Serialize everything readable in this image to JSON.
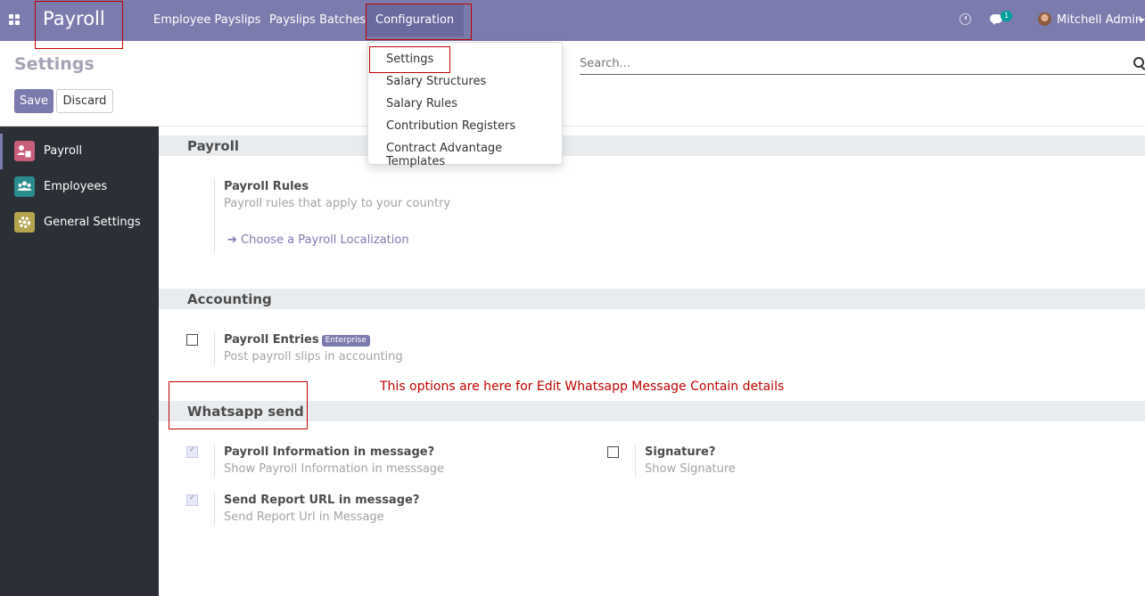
{
  "navbar": {
    "app_name": "Payroll",
    "menu": [
      "Employee Payslips",
      "Payslips Batches",
      "Configuration"
    ],
    "chat_count": "1",
    "user_name": "Mitchell Admin"
  },
  "dropdown": {
    "items": [
      "Settings",
      "Salary Structures",
      "Salary Rules",
      "Contribution Registers",
      "Contract Advantage Templates"
    ]
  },
  "control_panel": {
    "title": "Settings",
    "save_label": "Save",
    "discard_label": "Discard",
    "search_placeholder": "Search..."
  },
  "sidebar": {
    "items": [
      {
        "label": "Payroll",
        "icon": "payroll-icon",
        "color": "#c95e7a"
      },
      {
        "label": "Employees",
        "icon": "employees-icon",
        "color": "#2a8c8c"
      },
      {
        "label": "General Settings",
        "icon": "gear-icon",
        "color": "#b3a44d"
      }
    ]
  },
  "sections": {
    "payroll": {
      "title": "Payroll",
      "rules_title": "Payroll Rules",
      "rules_desc": "Payroll rules that apply to your country",
      "link": "Choose a Payroll Localization"
    },
    "accounting": {
      "title": "Accounting",
      "entries_title": "Payroll Entries",
      "entries_badge": "Enterprise",
      "entries_desc": "Post payroll slips in accounting",
      "entries_checked": false
    },
    "whatsapp": {
      "title": "Whatsapp send",
      "info_title": "Payroll Information in message?",
      "info_desc": "Show Payroll Information in messsage",
      "info_checked": true,
      "signature_title": "Signature?",
      "signature_desc": "Show Signature",
      "signature_checked": false,
      "url_title": "Send Report URL in message?",
      "url_desc": "Send Report Url in Message",
      "url_checked": true
    }
  },
  "annotation": "This options are here for Edit Whatsapp Message Contain details",
  "colors": {
    "brand": "#7c7bad",
    "annotation": "#c00000",
    "sidebar_bg": "#2b2f36"
  }
}
